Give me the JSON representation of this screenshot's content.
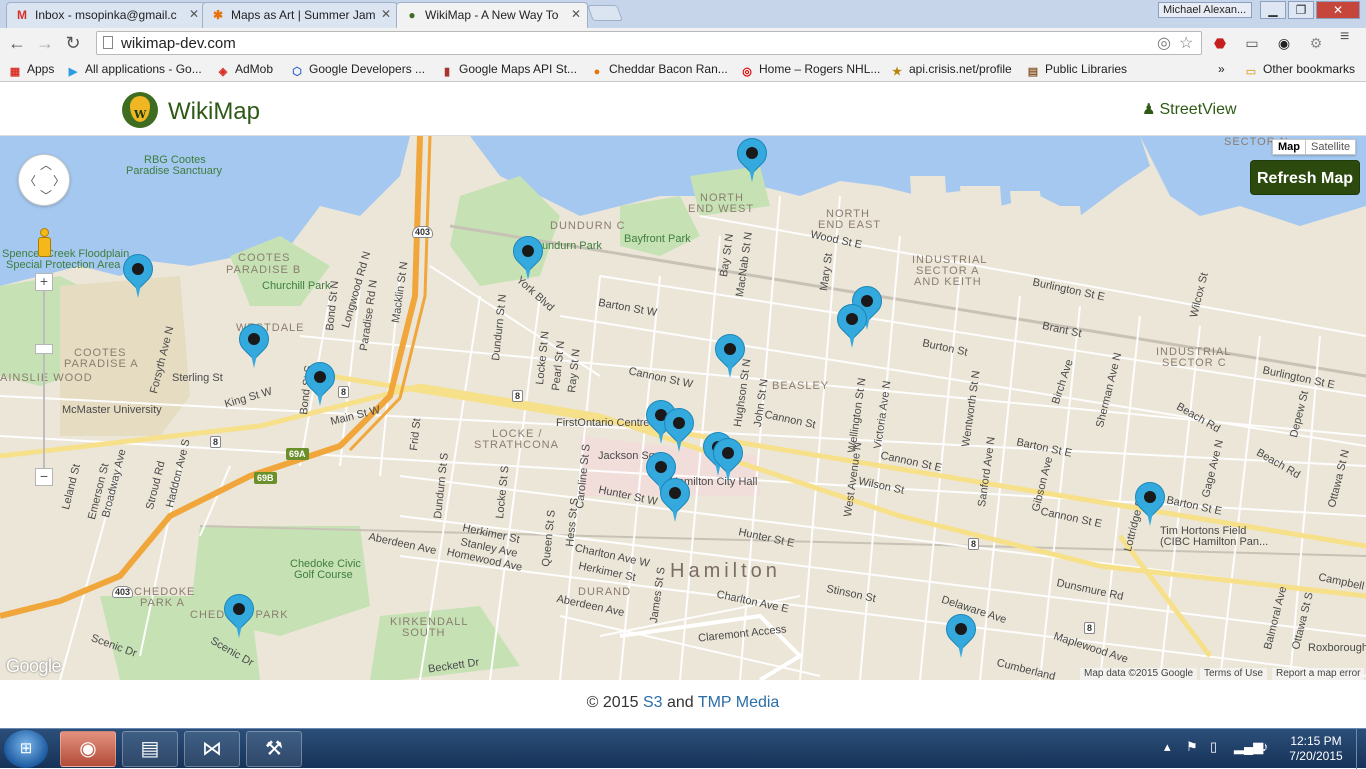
{
  "browser": {
    "tabs": [
      {
        "favicon": "M",
        "favicon_color": "#d93025",
        "title": "Inbox - msopinka@gmail.c"
      },
      {
        "favicon": "✱",
        "favicon_color": "#e8710a",
        "title": "Maps as Art | Summer Jam"
      },
      {
        "favicon": "●",
        "favicon_color": "#3e6d22",
        "title": "WikiMap - A New Way To"
      }
    ],
    "user_name": "Michael Alexan...",
    "url": "wikimap-dev.com",
    "bookmarks": [
      {
        "icon": "apps-grid-icon",
        "label": "Apps"
      },
      {
        "icon": "play-icon",
        "label": "All applications - Go..."
      },
      {
        "icon": "admob-icon",
        "label": "AdMob"
      },
      {
        "icon": "google-developers-icon",
        "label": "Google Developers ..."
      },
      {
        "icon": "maps-api-icon",
        "label": "Google Maps API St..."
      },
      {
        "icon": "cheddar-icon",
        "label": "Cheddar Bacon Ran..."
      },
      {
        "icon": "rogers-icon",
        "label": "Home – Rogers NHL..."
      },
      {
        "icon": "star-icon",
        "label": "api.crisis.net/profile"
      },
      {
        "icon": "library-icon",
        "label": "Public Libraries"
      }
    ],
    "bookmarks_overflow": "»",
    "other_bookmarks": "Other bookmarks"
  },
  "site": {
    "brand": "WikiMap",
    "streetview_label": "StreetView",
    "refresh_label": "Refresh Map",
    "footer_prefix": "© 2015 ",
    "footer_link1": "S3",
    "footer_mid": " and ",
    "footer_link2": "TMP Media"
  },
  "map": {
    "map_type": "Map",
    "satellite_type": "Satellite",
    "zoom_in": "+",
    "zoom_out": "−",
    "google": "Google",
    "attribution": "Map data ©2015 Google",
    "terms": "Terms of Use",
    "report": "Report a map error",
    "marker_color": "#34a9de",
    "labels": {
      "rbg": "RBG Cootes",
      "rbg2": "Paradise Sanctuary",
      "spencer": "Spencer Creek Floodplain",
      "spencer2": "Special Protection Area",
      "cootes_b": "COOTES",
      "cootes_b2": "PARADISE B",
      "churchill": "Churchill Park",
      "cootes_a": "COOTES",
      "cootes_a2": "PARADISE A",
      "mcmaster": "McMaster University",
      "ainslie": "AINSLIE WOOD",
      "westdale": "WESTDALE",
      "dundurn_c": "DUNDURN C",
      "dundurn_park": "Dundurn Park",
      "bayfront": "Bayfront Park",
      "north_end_w": "NORTH",
      "north_end_w2": "END WEST",
      "north_end_e": "NORTH",
      "north_end_e2": "END EAST",
      "industrial_a": "INDUSTRIAL",
      "industrial_a2": "SECTOR A",
      "industrial_a3": "AND KEITH",
      "industrial_c": "INDUSTRIAL",
      "industrial_c2": "SECTOR C",
      "sector_n": "SECTOR N",
      "beasley": "BEASLEY",
      "locke": "LOCKE /",
      "locke2": "STRATHCONA",
      "firstontario": "FirstOntario Centre",
      "jackson": "Jackson Sq",
      "cityhall": "Hamilton City Hall",
      "hamilton": "Hamilton",
      "durand": "DURAND",
      "kirkendall": "KIRKENDALL",
      "kirkendall2": "SOUTH",
      "chedoke_a": "CHEDOKE",
      "chedoke_a2": "PARK A",
      "chedoke_park": "CHEDOKE PARK",
      "chedoke_civic": "Chedoke Civic",
      "chedoke_civic2": "Golf Course",
      "tim_hortons": "Tim Hortons Field",
      "tim_hortons2": "(CIBC Hamilton Pan...",
      "claremont": "Claremont Access",
      "york": "York Blvd",
      "barton_w": "Barton St W",
      "cannon_w": "Cannon St W",
      "main_w": "Main St W",
      "king_w": "King St W",
      "sterling": "Sterling St",
      "hunter_w": "Hunter St W",
      "herkimer": "Herkimer St",
      "stanley": "Stanley Ave",
      "homewood": "Homewood Ave",
      "aberdeen": "Aberdeen Ave",
      "aberdeen2": "Aberdeen Ave",
      "charlton": "Charlton Ave W",
      "herkimer2": "Herkimer St",
      "charlton_e": "Charlton Ave E",
      "hunter_e": "Hunter St E",
      "cannon": "Cannon St",
      "cannon_e": "Cannon St E",
      "barton_e": "Barton St E",
      "burlington": "Burlington St E",
      "burlington2": "Burlington St E",
      "brant": "Brant St",
      "burton": "Burton St",
      "wilson": "Wilson St",
      "wood": "Wood St E",
      "stinson": "Stinson St",
      "dunsmure": "Dunsmure Rd",
      "maplewood": "Maplewood Ave",
      "delaware": "Delaware Ave",
      "cumberland": "Cumberland",
      "beckett": "Beckett Dr",
      "scenic": "Scenic Dr",
      "scenic2": "Scenic Dr",
      "beach": "Beach Rd",
      "beach2": "Beach Rd",
      "barton_e2": "Barton St E",
      "cannon_e2": "Cannon St E",
      "campbell": "Campbell",
      "roxborough": "Roxborough",
      "wellington": "Wellington St N",
      "victoria": "Victoria Ave N",
      "west_ave": "West Avenue N",
      "wentworth": "Wentworth St N",
      "sanford": "Sanford Ave N",
      "birch": "Birch Ave",
      "sherman": "Sherman Ave N",
      "lottridge": "Lottridge St",
      "gage": "Gage Ave N",
      "ottawa": "Ottawa St N",
      "depew": "Depew St",
      "wilcox": "Wilcox St",
      "hughson": "Hughson St N",
      "john": "John St N",
      "james": "James St S",
      "bay": "Bay St N",
      "macnab": "MacNab St N",
      "mary": "Mary St",
      "dundurn_st": "Dundurn St N",
      "dundurn_st_s": "Dundurn St S",
      "locke_n": "Locke St N",
      "locke_s": "Locke St S",
      "pearl": "Pearl St N",
      "ray": "Ray St N",
      "queen": "Queen St S",
      "hess": "Hess St S",
      "caroline": "Caroline St S",
      "frid": "Frid St",
      "bond": "Bond St N",
      "bond_s": "Bond St S",
      "paradise": "Paradise Rd N",
      "longwood": "Longwood Rd N",
      "macklin": "Macklin St N",
      "forsyth": "Forsyth Ave N",
      "leland": "Leland St",
      "emerson": "Emerson St",
      "broadway": "Broadway Ave",
      "stroud": "Stroud Rd",
      "haddon": "Haddon Ave S",
      "gibson": "Gibson Ave",
      "balmoral": "Balmoral Ave",
      "ottawa_s": "Ottawa St S",
      "highway403": "403",
      "highway403b": "403",
      "route8": "8",
      "route8b": "8",
      "route8c": "8",
      "route8d": "8",
      "route8e": "8",
      "ramp69a": "69A",
      "ramp69b": "69B"
    }
  },
  "taskbar": {
    "time": "12:15 PM",
    "date": "7/20/2015"
  }
}
